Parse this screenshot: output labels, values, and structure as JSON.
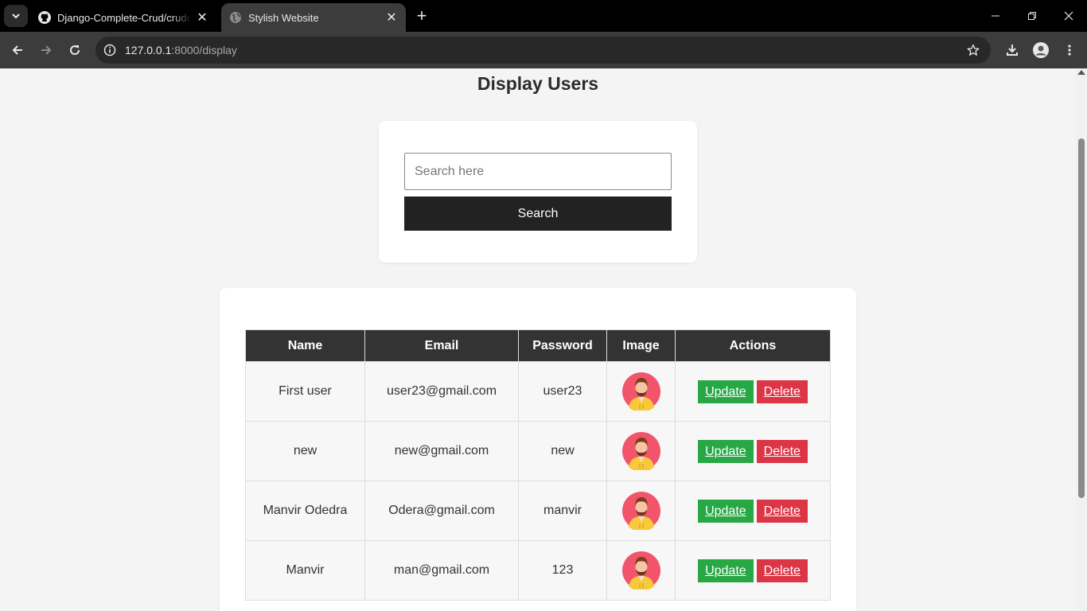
{
  "browser": {
    "tabs": [
      {
        "title": "Django-Complete-Crud/crudop",
        "favicon": "github-icon",
        "active": false
      },
      {
        "title": "Stylish Website",
        "favicon": "globe-icon",
        "active": true
      }
    ],
    "url_host": "127.0.0.1",
    "url_path": ":8000/display"
  },
  "page": {
    "title": "Display Users",
    "search": {
      "placeholder": "Search here",
      "value": "",
      "button_label": "Search"
    },
    "table": {
      "headers": [
        "Name",
        "Email",
        "Password",
        "Image",
        "Actions"
      ],
      "rows": [
        {
          "name": "First user",
          "email": "user23@gmail.com",
          "password": "user23",
          "image": "avatar-icon",
          "update": "Update",
          "delete": "Delete"
        },
        {
          "name": "new",
          "email": "new@gmail.com",
          "password": "new",
          "image": "avatar-icon",
          "update": "Update",
          "delete": "Delete"
        },
        {
          "name": "Manvir Odedra",
          "email": "Odera@gmail.com",
          "password": "manvir",
          "image": "avatar-icon",
          "update": "Update",
          "delete": "Delete"
        },
        {
          "name": "Manvir",
          "email": "man@gmail.com",
          "password": "123",
          "image": "avatar-icon",
          "update": "Update",
          "delete": "Delete"
        }
      ]
    }
  },
  "colors": {
    "update": "#28a745",
    "delete": "#dc3545",
    "header_bg": "#333333",
    "search_button": "#222222"
  }
}
